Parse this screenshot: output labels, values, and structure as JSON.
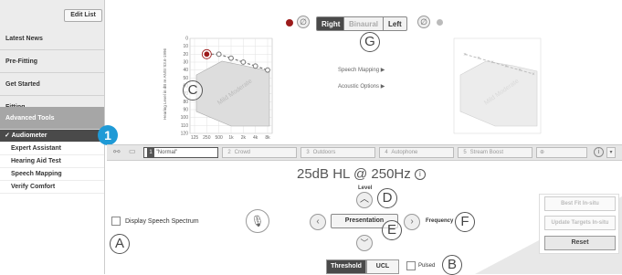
{
  "sidebar": {
    "edit_list_label": "Edit List",
    "items": [
      "Latest News",
      "Pre-Fitting",
      "Get Started",
      "Fitting",
      "Advanced Tools"
    ],
    "sub_items": [
      "Audiometer",
      "Expert Assistant",
      "Hearing Aid Test",
      "Speech Mapping",
      "Verify Comfort"
    ],
    "active_sub": "Audiometer",
    "active_check": "✓"
  },
  "ear_selector": {
    "right": "Right",
    "binaural": "Binaural",
    "left": "Left"
  },
  "audiogram": {
    "y_label": "Hearing Level in dB re ANSI S3.6-1996",
    "y_ticks": [
      "0",
      "10",
      "20",
      "30",
      "40",
      "50",
      "60",
      "70",
      "80",
      "90",
      "100",
      "110",
      "120"
    ],
    "x_ticks": [
      "125",
      "250",
      "500",
      "1k",
      "2k",
      "4k",
      "8k"
    ],
    "watermark": "Mild  Moderate",
    "right_points_db": [
      20,
      20,
      25,
      30,
      35,
      40
    ],
    "left_points_db": [
      20,
      25,
      30,
      35,
      40,
      45
    ]
  },
  "side_links": {
    "speech_mapping": "Speech Mapping",
    "acoustic_options": "Acoustic Options"
  },
  "programs": [
    {
      "num": "1",
      "name": "Normal",
      "selected": true
    },
    {
      "num": "2",
      "name": "Crowd"
    },
    {
      "num": "3",
      "name": "Outdoors"
    },
    {
      "num": "4",
      "name": "Autophone"
    },
    {
      "num": "5",
      "name": "Stream Boost"
    }
  ],
  "audiometer": {
    "reading": "25dB HL @ 250Hz",
    "level_label": "Level",
    "presentation_label": "Presentation",
    "frequency_label": "Frequency",
    "display_speech_label": "Display Speech Spectrum",
    "threshold_label": "Threshold",
    "ucl_label": "UCL",
    "pulsed_label": "Pulsed"
  },
  "right_panel": {
    "best_fit": "Best Fit In-situ",
    "update_targets": "Update Targets In-situ",
    "reset": "Reset"
  },
  "callouts": {
    "a": "A",
    "b": "B",
    "c": "C",
    "d": "D",
    "e": "E",
    "f": "F",
    "g": "G",
    "one": "1"
  },
  "colors": {
    "right_ear": "#9c1b1b",
    "accent": "#1f9ad6",
    "sidebar_active": "#4a4a4a"
  }
}
